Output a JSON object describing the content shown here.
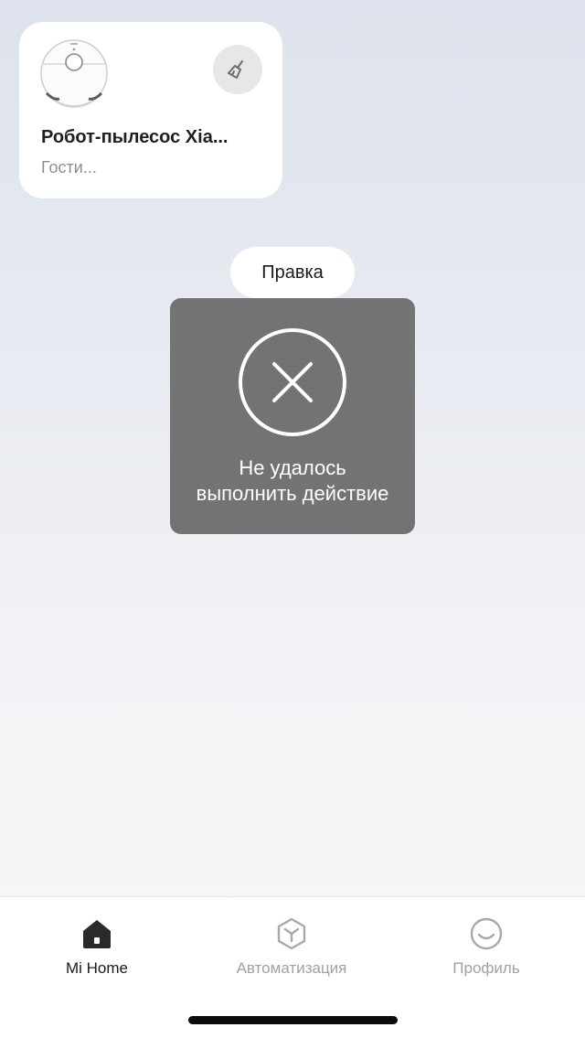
{
  "device_card": {
    "name": "Робот-пылесос Xia...",
    "room": "Гости..."
  },
  "edit_label": "Правка",
  "toast": {
    "line1": "Не удалось",
    "line2": "выполнить действие"
  },
  "tabs": [
    {
      "label": "Mi Home",
      "icon": "home-icon",
      "active": true
    },
    {
      "label": "Автоматизация",
      "icon": "cube-icon",
      "active": false
    },
    {
      "label": "Профиль",
      "icon": "smile-icon",
      "active": false
    }
  ],
  "colors": {
    "toast_bg": "#727375",
    "active_tab": "#1a1a1a",
    "inactive_tab": "#a1a1a3"
  }
}
